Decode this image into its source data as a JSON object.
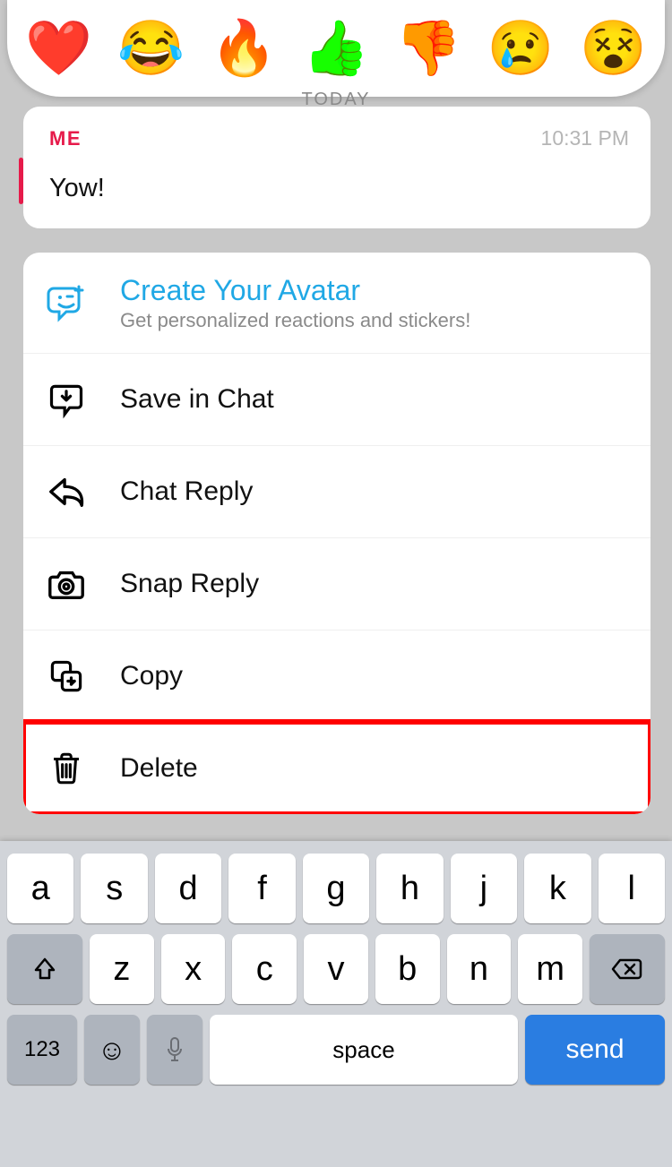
{
  "reactions": [
    "❤️",
    "😂",
    "🔥",
    "👍",
    "👎",
    "😢",
    "😵"
  ],
  "date_separator": "TODAY",
  "message": {
    "sender": "ME",
    "time": "10:31 PM",
    "body": "Yow!"
  },
  "menu": {
    "avatar": {
      "title": "Create Your Avatar",
      "sub": "Get personalized reactions and stickers!"
    },
    "save": "Save in Chat",
    "chat_reply": "Chat Reply",
    "snap_reply": "Snap Reply",
    "copy": "Copy",
    "delete": "Delete"
  },
  "keyboard": {
    "row1": [
      "a",
      "s",
      "d",
      "f",
      "g",
      "h",
      "j",
      "k",
      "l"
    ],
    "row2": [
      "z",
      "x",
      "c",
      "v",
      "b",
      "n",
      "m"
    ],
    "fn": "123",
    "space": "space",
    "send": "send"
  }
}
